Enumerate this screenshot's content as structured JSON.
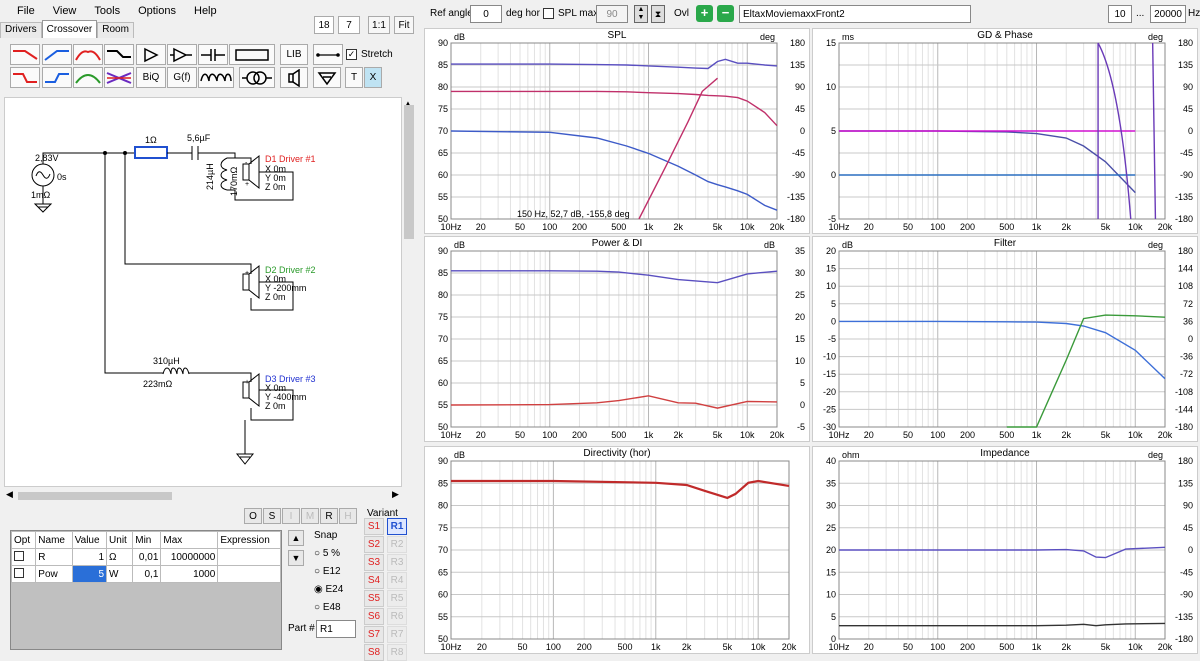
{
  "menu": [
    "File",
    "View",
    "Tools",
    "Options",
    "Help"
  ],
  "tabs": [
    "Drivers",
    "Crossover",
    "Room"
  ],
  "tabs_active": 1,
  "zoom": {
    "a": "18",
    "b": "7",
    "one": "1:1",
    "fit": "Fit"
  },
  "toolbar": {
    "lib": "LIB",
    "stretch": "Stretch",
    "biq": "BiQ",
    "gf": "G(f)",
    "t": "T",
    "x": "X"
  },
  "schematic": {
    "voltage": "2,83V",
    "delay": "0s",
    "rout": "1mΩ",
    "r1": "1Ω",
    "c1": "5,6µF",
    "l1": "214µH",
    "l1r": "170mΩ",
    "l2": "310µH",
    "l2r": "223mΩ",
    "d1": {
      "name": "D1 Driver #1",
      "x": "X 0m",
      "y": "Y 0m",
      "z": "Z 0m"
    },
    "d2": {
      "name": "D2 Driver #2",
      "x": "X 0m",
      "y": "Y -200mm",
      "z": "Z 0m"
    },
    "d3": {
      "name": "D3 Driver #3",
      "x": "X 0m",
      "y": "Y -400mm",
      "z": "Z 0m"
    }
  },
  "osbuttons": [
    "O",
    "S",
    "I",
    "M",
    "R",
    "H"
  ],
  "params": {
    "headers": [
      "Opt",
      "Name",
      "Value",
      "Unit",
      "Min",
      "Max",
      "Expression"
    ],
    "rows": [
      {
        "name": "R",
        "value": "1",
        "unit": "Ω",
        "min": "0,01",
        "max": "10000000"
      },
      {
        "name": "Pow",
        "value": "5",
        "unit": "W",
        "min": "0,1",
        "max": "1000"
      }
    ]
  },
  "snap": {
    "label": "Snap",
    "options": [
      "5 %",
      "E12",
      "E24",
      "E48"
    ],
    "selected": 2
  },
  "part": {
    "label": "Part #",
    "value": "R1"
  },
  "variant": {
    "label": "Variant",
    "s": [
      "S1",
      "S2",
      "S3",
      "S4",
      "S5",
      "S6",
      "S7",
      "S8"
    ],
    "r": [
      "R1",
      "R2",
      "R3",
      "R4",
      "R5",
      "R6",
      "R7",
      "R8"
    ]
  },
  "topbar": {
    "ref_label": "Ref angle",
    "ref_value": "0",
    "deg_hor": "deg hor",
    "splmax": "SPL max",
    "splmax_value": "90",
    "ovl": "Ovl",
    "file": "EltaxMoviemaxxFront2",
    "f1": "10",
    "dots": "...",
    "f2": "20000",
    "hz": "Hz"
  },
  "charts": {
    "spl": {
      "title": "SPL",
      "lunit": "dB",
      "runit": "deg",
      "left": [
        "90",
        "85",
        "80",
        "75",
        "70",
        "65",
        "60",
        "55",
        "50"
      ],
      "right": [
        "180",
        "135",
        "90",
        "45",
        "0",
        "-45",
        "-90",
        "-135",
        "-180"
      ],
      "x": [
        "10Hz",
        "20",
        "50",
        "100",
        "200",
        "500",
        "1k",
        "2k",
        "5k",
        "10k",
        "20k"
      ],
      "cursor": "150 Hz, 52,7 dB, -155,8 deg"
    },
    "gd": {
      "title": "GD & Phase",
      "lunit": "ms",
      "runit": "deg",
      "left": [
        "15",
        "",
        "10",
        "",
        "5",
        "",
        "0",
        "",
        "-5"
      ],
      "right": [
        "180",
        "135",
        "90",
        "45",
        "0",
        "-45",
        "-90",
        "-135",
        "-180"
      ],
      "x": [
        "10Hz",
        "20",
        "50",
        "100",
        "200",
        "500",
        "1k",
        "2k",
        "5k",
        "10k",
        "20k"
      ]
    },
    "pow": {
      "title": "Power & DI",
      "lunit": "dB",
      "runit": "dB",
      "left": [
        "90",
        "85",
        "80",
        "75",
        "70",
        "65",
        "60",
        "55",
        "50"
      ],
      "right": [
        "35",
        "30",
        "25",
        "20",
        "15",
        "10",
        "5",
        "0",
        "-5"
      ],
      "x": [
        "10Hz",
        "20",
        "50",
        "100",
        "200",
        "500",
        "1k",
        "2k",
        "5k",
        "10k",
        "20k"
      ]
    },
    "filter": {
      "title": "Filter",
      "lunit": "dB",
      "runit": "deg",
      "left": [
        "20",
        "15",
        "10",
        "5",
        "0",
        "-5",
        "-10",
        "-15",
        "-20",
        "-25",
        "-30"
      ],
      "right": [
        "180",
        "144",
        "108",
        "72",
        "36",
        "0",
        "-36",
        "-72",
        "-108",
        "-144",
        "-180"
      ],
      "x": [
        "10Hz",
        "20",
        "50",
        "100",
        "200",
        "500",
        "1k",
        "2k",
        "5k",
        "10k",
        "20k"
      ]
    },
    "dir": {
      "title": "Directivity (hor)",
      "lunit": "dB",
      "runit": "",
      "left": [
        "90",
        "85",
        "80",
        "75",
        "70",
        "65",
        "60",
        "55",
        "50"
      ],
      "right": [],
      "x": [
        "10Hz",
        "20",
        "50",
        "100",
        "200",
        "500",
        "1k",
        "2k",
        "5k",
        "10k",
        "20k"
      ]
    },
    "imp": {
      "title": "Impedance",
      "lunit": "ohm",
      "runit": "deg",
      "left": [
        "40",
        "35",
        "30",
        "25",
        "20",
        "15",
        "10",
        "5",
        "0"
      ],
      "right": [
        "180",
        "135",
        "90",
        "45",
        "0",
        "-45",
        "-90",
        "-135",
        "-180"
      ],
      "x": [
        "10Hz",
        "20",
        "50",
        "100",
        "200",
        "500",
        "1k",
        "2k",
        "5k",
        "10k",
        "20k"
      ]
    }
  },
  "chart_data": [
    {
      "type": "line",
      "title": "SPL",
      "ylim": [
        50,
        90
      ],
      "y2lim": [
        -180,
        180
      ],
      "x": [
        10,
        100,
        300,
        600,
        1000,
        2000,
        3000,
        4000,
        5000,
        6000,
        8000,
        10000,
        15000,
        20000
      ],
      "series": [
        {
          "color": "#5a4fc0",
          "values": [
            85.2,
            85.2,
            85.1,
            85.0,
            84.8,
            84.5,
            84.3,
            84.2,
            85.8,
            86.3,
            85.4,
            85.4,
            85.0,
            84.8
          ]
        },
        {
          "color": "#3d5bc8",
          "values": [
            70.0,
            69.7,
            68.4,
            66.6,
            64.9,
            62.0,
            60.0,
            58.5,
            57.8,
            57.3,
            56.4,
            55.6,
            53.1,
            52.0
          ]
        },
        {
          "color": "#c0306a",
          "values": [
            79.0,
            79.0,
            79.0,
            78.9,
            78.7,
            78.5,
            78.3,
            78.1,
            78.0,
            77.9,
            77.6,
            76.8,
            74.2,
            71.2
          ]
        }
      ]
    },
    {
      "type": "line",
      "title": "Power & DI",
      "ylim": [
        50,
        90
      ],
      "y2lim": [
        -5,
        35
      ],
      "x": [
        10,
        100,
        300,
        500,
        1000,
        2000,
        3000,
        5000,
        10000,
        20000
      ],
      "series": [
        {
          "color": "#5a4fc0",
          "values": [
            85.5,
            85.5,
            85.4,
            85.2,
            84.5,
            83.5,
            83.2,
            82.8,
            84.8,
            85.4
          ]
        },
        {
          "color": "#d04040",
          "values": [
            55.0,
            55.1,
            55.5,
            56.0,
            57.1,
            55.5,
            55.4,
            54.3,
            55.8,
            55.7
          ]
        }
      ]
    },
    {
      "type": "line",
      "title": "Filter",
      "ylim": [
        -30,
        20
      ],
      "y2lim": [
        -180,
        180
      ],
      "x": [
        10,
        100,
        500,
        1000,
        2000,
        3000,
        5000,
        10000,
        20000
      ],
      "series": [
        {
          "color": "#3d6fd8",
          "values": [
            0,
            0,
            -0.1,
            -0.2,
            -0.6,
            -1.3,
            -3.2,
            -8.2,
            -16.3
          ]
        },
        {
          "color": "#3a9a3a",
          "values": [
            null,
            null,
            -44,
            -30,
            -11,
            0.8,
            1.8,
            1.6,
            1.2
          ]
        }
      ]
    },
    {
      "type": "line",
      "title": "Directivity (hor)",
      "ylim": [
        50,
        90
      ],
      "x": [
        10,
        100,
        1000,
        2000,
        3000,
        5000,
        6000,
        8000,
        10000,
        20000
      ],
      "series": [
        {
          "color": "#c02a2a",
          "values": [
            85.5,
            85.5,
            85.1,
            84.6,
            83.3,
            81.7,
            82.6,
            85.1,
            85.5,
            84.4
          ]
        }
      ]
    },
    {
      "type": "line",
      "title": "Impedance",
      "ylim": [
        0,
        40
      ],
      "y2lim": [
        -180,
        180
      ],
      "x": [
        10,
        100,
        1000,
        2000,
        3000,
        4000,
        5000,
        8000,
        20000
      ],
      "series": [
        {
          "color": "#5a4fc0",
          "values": [
            20.0,
            20.0,
            20.0,
            20.1,
            19.8,
            18.4,
            18.3,
            20.2,
            20.6
          ]
        },
        {
          "color": "#333333",
          "values": [
            3.0,
            3.0,
            3.0,
            3.1,
            3.3,
            3.0,
            3.2,
            3.4,
            3.5
          ]
        }
      ]
    },
    {
      "type": "line",
      "title": "GD & Phase",
      "ylim": [
        -5,
        15
      ],
      "y2lim": [
        -180,
        180
      ],
      "x": [
        10,
        100,
        500,
        1000,
        2000,
        3000,
        5000,
        10000
      ],
      "series": [
        {
          "color": "#4a4fa8",
          "values": [
            5.0,
            5.0,
            4.9,
            4.7,
            4.2,
            3.3,
            1.5,
            -2.0
          ]
        },
        {
          "color": "#2a6fc0",
          "values": [
            0,
            0,
            0,
            0,
            0,
            0,
            0,
            0
          ]
        },
        {
          "color": "#d010d0",
          "values": [
            5.0,
            5.0,
            5.0,
            5.0,
            5.0,
            5.0,
            5.0,
            5.0
          ]
        }
      ]
    }
  ]
}
